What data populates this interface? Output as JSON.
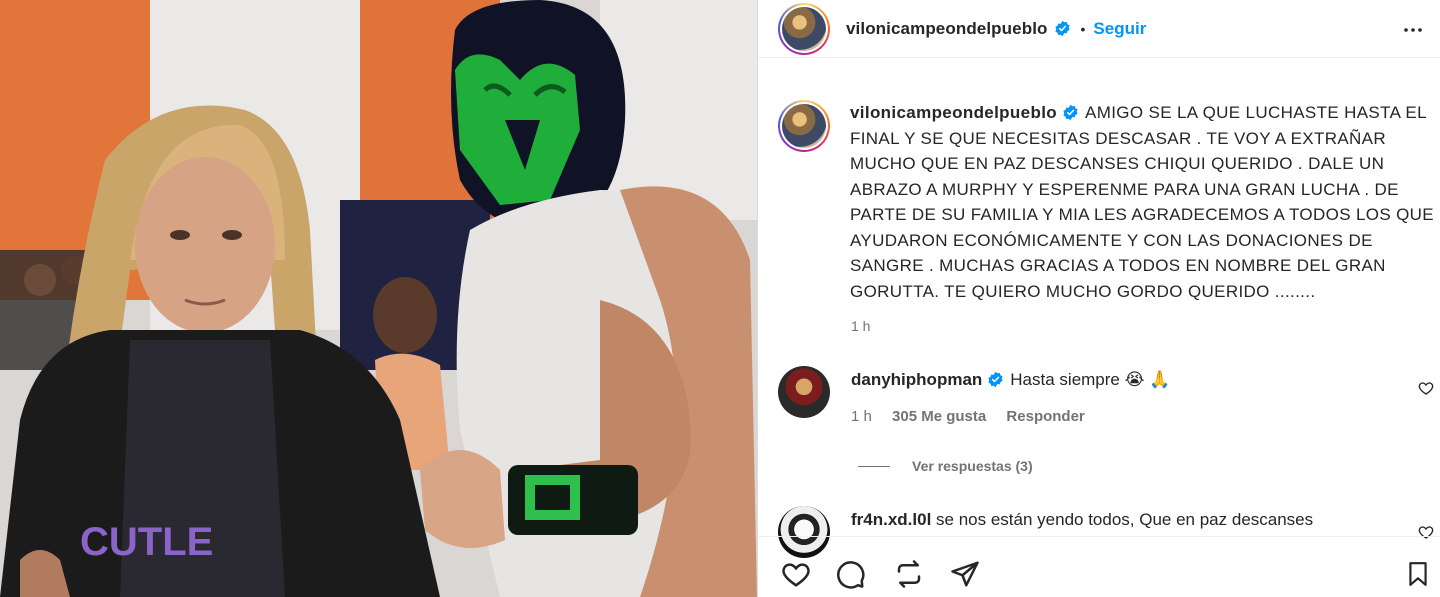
{
  "post": {
    "username": "vilonicampeondelpueblo",
    "follow_label": "Seguir",
    "separator": "•",
    "caption": "AMIGO SE LA QUE LUCHASTE HASTA EL FINAL Y SE QUE NECESITAS DESCASAR . TE VOY A EXTRAÑAR MUCHO QUE EN PAZ DESCANSES CHIQUI QUERIDO . DALE UN ABRAZO A MURPHY Y ESPERENME PARA UNA GRAN LUCHA . DE PARTE DE SU FAMILIA Y MIA LES AGRADECEMOS A TODOS LOS QUE AYUDARON ECONÓMICAMENTE Y CON LAS DONACIONES DE SANGRE . MUCHAS GRACIAS A TODOS EN NOMBRE DEL GRAN GORUTTA. TE QUIERO MUCHO GORDO QUERIDO ........",
    "time": "1 h"
  },
  "comments": [
    {
      "username": "danyhiphopman",
      "text": "Hasta siempre 😭 🙏",
      "time": "1 h",
      "likes": "305 Me gusta",
      "reply": "Responder",
      "view_replies": "Ver respuestas (3)"
    },
    {
      "username": "fr4n.xd.l0l",
      "text": "se nos están yendo todos, Que en paz descanses"
    }
  ],
  "icons": {
    "verified": "verified-badge-icon",
    "more": "more-options-icon",
    "like": "heart-icon",
    "comment": "comment-icon",
    "share": "share-icon",
    "send": "send-icon",
    "save": "bookmark-icon"
  },
  "colors": {
    "accent": "#0095f6",
    "text": "#262626",
    "muted": "#737373"
  }
}
